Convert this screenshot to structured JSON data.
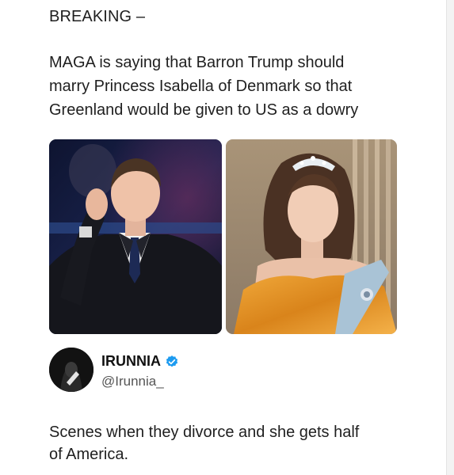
{
  "post": {
    "kicker": "BREAKING –",
    "headline_lines": [
      "MAGA is saying that Barron Trump should",
      "marry Princess Isabella of Denmark so that",
      "Greenland would be given to US as a dowry"
    ]
  },
  "media": [
    {
      "icon": "photo-young-man-in-suit"
    },
    {
      "icon": "photo-princess-in-gold-gown"
    }
  ],
  "account": {
    "display_name": "IRUNNIA",
    "handle": "@Irunnia_",
    "verified_icon": "verified-badge-icon",
    "verified_color": "#1d9bf0"
  },
  "reply": {
    "lines": [
      "Scenes when they divorce and she gets half",
      "of America."
    ]
  }
}
